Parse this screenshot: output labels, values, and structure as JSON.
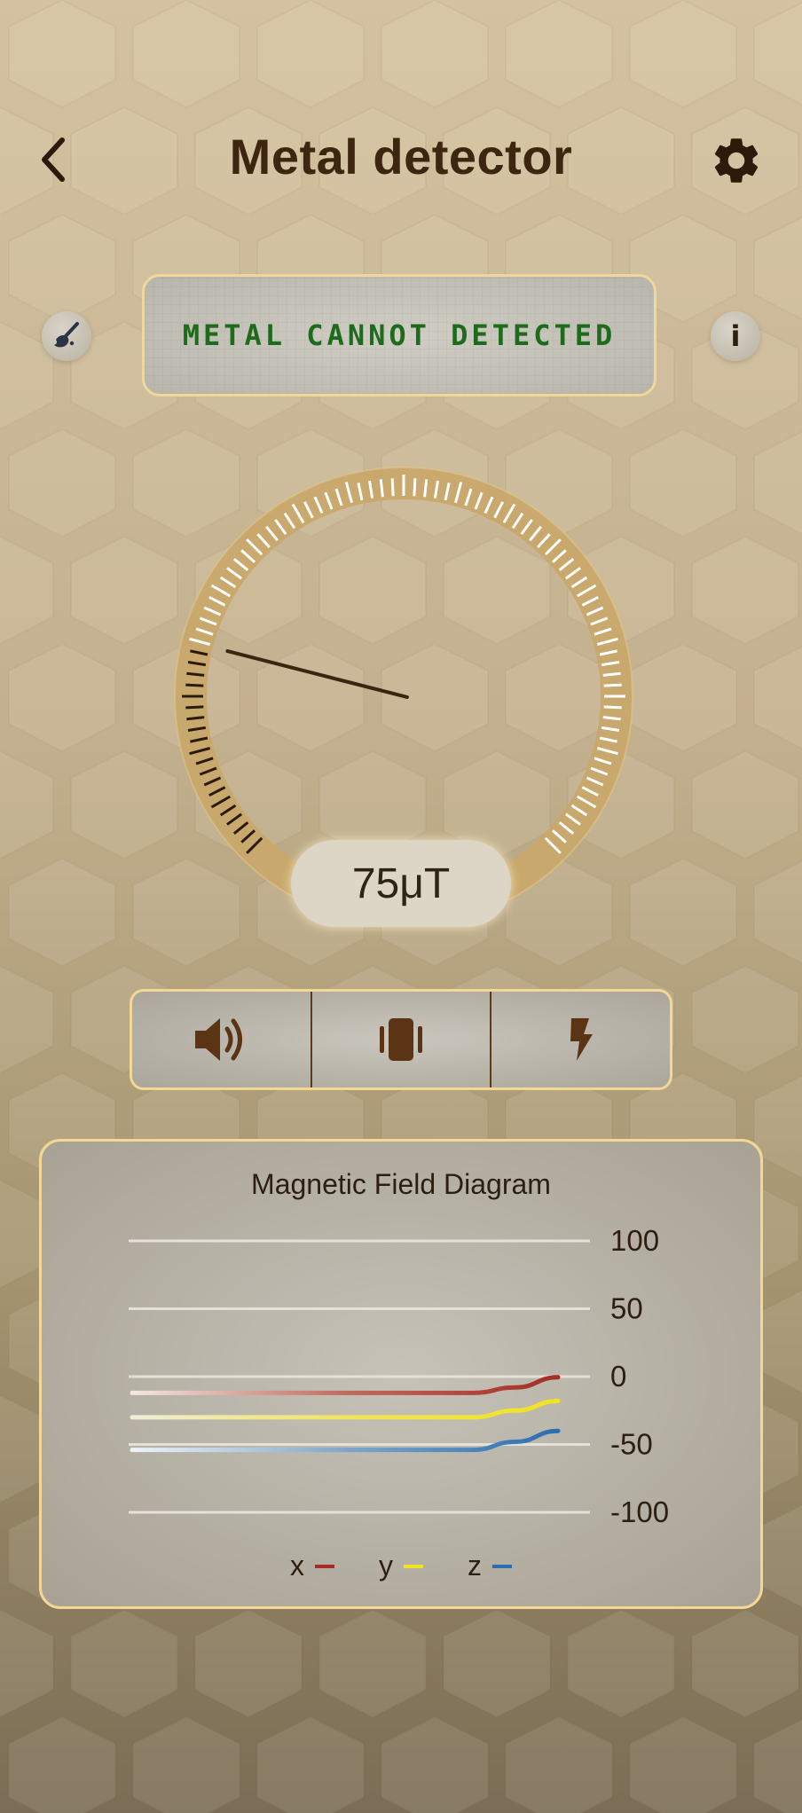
{
  "header": {
    "title": "Metal detector",
    "back_icon": "chevron-left-icon",
    "settings_icon": "gear-icon"
  },
  "status": {
    "message": "METAL CANNOT DETECTED",
    "color": "#1e6b1c"
  },
  "side_buttons": {
    "left_icon": "brush-icon",
    "right_icon": "info-icon",
    "right_label": "i"
  },
  "gauge": {
    "value": 75,
    "unit": "μT",
    "display": "75μT",
    "level_fraction": 0.22
  },
  "toggles": [
    {
      "name": "sound",
      "icon": "speaker-icon"
    },
    {
      "name": "vibration",
      "icon": "vibrate-icon"
    },
    {
      "name": "flash",
      "icon": "flash-icon"
    }
  ],
  "diagram": {
    "title": "Magnetic Field Diagram"
  },
  "chart_data": {
    "type": "line",
    "title": "Magnetic Field Diagram",
    "ylim": [
      -100,
      100
    ],
    "yticks": [
      "100",
      "50",
      "0",
      "-50",
      "-100"
    ],
    "ytick_values": [
      100,
      50,
      0,
      -50,
      -100
    ],
    "grid": true,
    "legend_placement": "bottom",
    "x": [
      0,
      1,
      2,
      3,
      4,
      5,
      6,
      7,
      8,
      9,
      10
    ],
    "series": [
      {
        "name": "x",
        "color": "#a52d25",
        "values": [
          -12,
          -12,
          -12,
          -12,
          -12,
          -12,
          -12,
          -12,
          -12,
          -8,
          -0.5
        ]
      },
      {
        "name": "y",
        "color": "#f2e320",
        "values": [
          -30,
          -30,
          -30,
          -30,
          -30,
          -30,
          -30,
          -30,
          -30,
          -25,
          -18
        ]
      },
      {
        "name": "z",
        "color": "#2a6eaf",
        "values": [
          -54,
          -54,
          -54,
          -54,
          -54,
          -54,
          -54,
          -54,
          -54,
          -48,
          -40
        ]
      }
    ]
  }
}
